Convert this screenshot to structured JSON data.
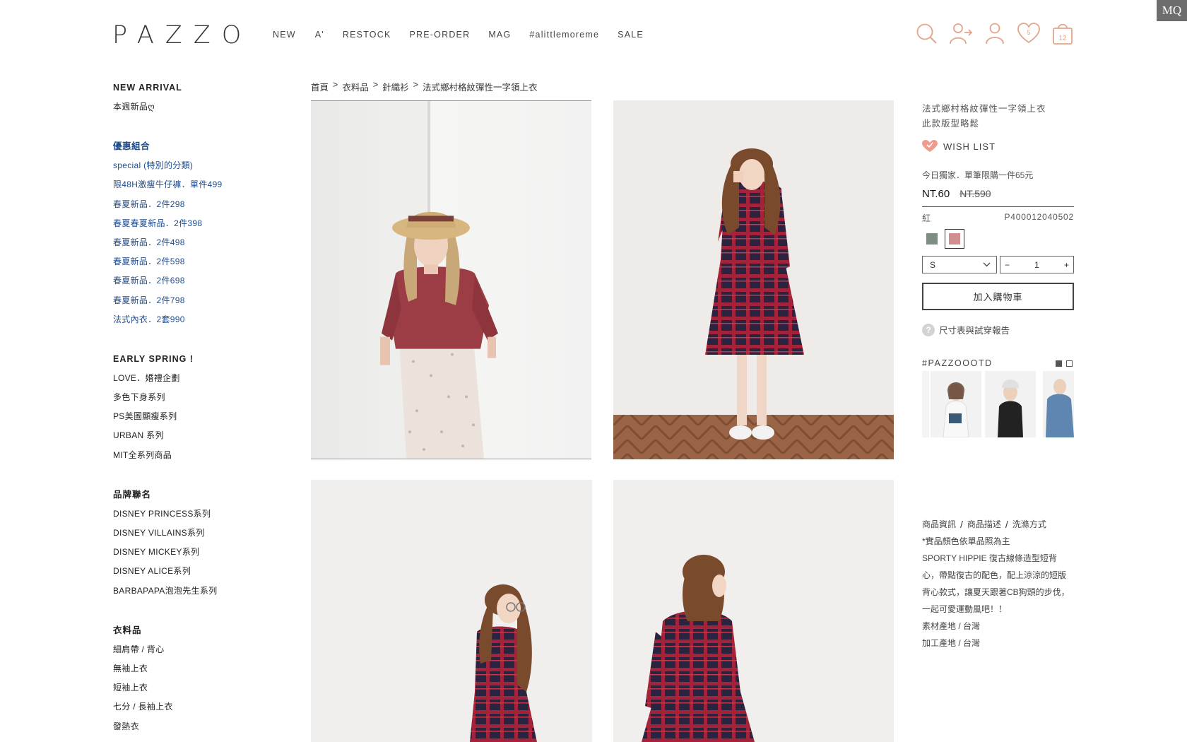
{
  "badge": "MQ",
  "brand": {
    "logo": "PAZZO"
  },
  "nav": [
    "NEW",
    "A'",
    "RESTOCK",
    "PRE-ORDER",
    "MAG",
    "#alittlemoreme",
    "SALE"
  ],
  "header_icons": {
    "search": "search-icon",
    "share": "share-user-icon",
    "account": "user-icon",
    "wishlist": "heart-icon",
    "wishlist_count": "5",
    "cart": "bag-icon",
    "cart_count": "12",
    "accent_color": "#e4a489"
  },
  "sidebar": {
    "groups": [
      {
        "title": "NEW ARRIVAL",
        "blue": false,
        "items": [
          "本週新品ღ"
        ]
      },
      {
        "title": "優惠組合",
        "blue": true,
        "items": [
          "special (特別的分類)",
          "限48H激瘦牛仔褲．單件499",
          "春夏新品．2件298",
          "春夏春夏新品．2件398",
          "春夏新品．2件498",
          "春夏新品．2件598",
          "春夏新品．2件698",
          "春夏新品．2件798",
          "法式內衣．2套990"
        ]
      },
      {
        "title": "EARLY SPRING !",
        "blue": false,
        "items": [
          "LOVE．婚禮企劃",
          "多色下身系列",
          "PS美圖顯瘦系列",
          "URBAN 系列",
          "MIT全系列商品"
        ]
      },
      {
        "title": "品牌聯名",
        "blue": false,
        "items": [
          "DISNEY PRINCESS系列",
          "DISNEY VILLAINS系列",
          "DISNEY MICKEY系列",
          "DISNEY ALICE系列",
          "BARBAPAPA泡泡先生系列"
        ]
      },
      {
        "title": "衣料品",
        "blue": false,
        "items": [
          "細肩帶 / 背心",
          "無袖上衣",
          "短袖上衣",
          "七分 / 長袖上衣",
          "發熱衣"
        ]
      }
    ],
    "link_color": "#1f4c8f"
  },
  "breadcrumb": [
    "首頁",
    "衣料品",
    "針織衫",
    "法式鄉村格紋彈性一字領上衣"
  ],
  "product": {
    "name_line1": "法式鄉村格紋彈性一字領上衣",
    "name_line2": "此款版型略鬆",
    "wish_label": "WISH LIST",
    "promo": "今日獨家．單筆限購一件65元",
    "price_now": "NT.60",
    "price_old": "NT.590",
    "color_label": "紅",
    "sku": "P400012040502",
    "swatch_colors": [
      "#7e8e82",
      "#cf8f8f"
    ],
    "size_value": "S",
    "qty_minus": "−",
    "qty_value": "1",
    "qty_plus": "+",
    "add_to_cart": "加入購物車",
    "size_chart_link": "尺寸表與試穿報告",
    "ootd_title": "#PAZZOOOTD"
  },
  "description": {
    "tabs": [
      "商品資訊",
      "商品描述",
      "洗滌方式"
    ],
    "lines": [
      "*實品顏色依單品照為主",
      "SPORTY HIPPIE 復古線條造型短背",
      "心，帶點復古的配色，配上涼涼的短版",
      "背心款式，讓夏天跟著CB狗頭的步伐，",
      "一起可愛運動風吧！！",
      "素材產地 / 台灣",
      "加工產地 / 台灣"
    ]
  }
}
